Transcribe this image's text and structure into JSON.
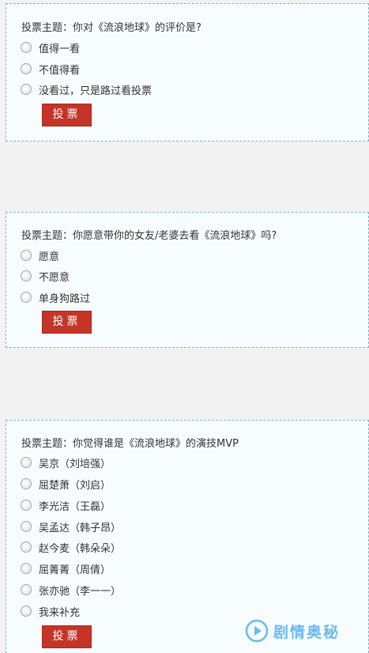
{
  "polls": [
    {
      "title": "投票主题：你对《流浪地球》的评价是?",
      "options": [
        "值得一看",
        "不值得看",
        "没看过，只是路过看投票"
      ],
      "button_label": "投票"
    },
    {
      "title": "投票主题：你愿意带你的女友/老婆去看《流浪地球》吗?",
      "options": [
        "愿意",
        "不愿意",
        "单身狗路过"
      ],
      "button_label": "投票"
    },
    {
      "title": "投票主题：你觉得谁是《流浪地球》的演技MVP",
      "options": [
        "吴京（刘培强）",
        "屈楚萧（刘启）",
        "李光洁（王磊）",
        "吴孟达（韩子昂）",
        "赵今麦（韩朵朵）",
        "屈菁菁（周倩）",
        "张亦驰（李一一）",
        "我来补充"
      ],
      "button_label": "投票"
    }
  ],
  "watermark": {
    "text": "剧情奥秘",
    "icon": "play-logo-icon",
    "color": "#3fa4e6"
  },
  "colors": {
    "button": "#c43527",
    "panel_border": "#7fb4d6",
    "panel_bg": "#f7fcff",
    "page_bg": "#f2f2f2"
  }
}
